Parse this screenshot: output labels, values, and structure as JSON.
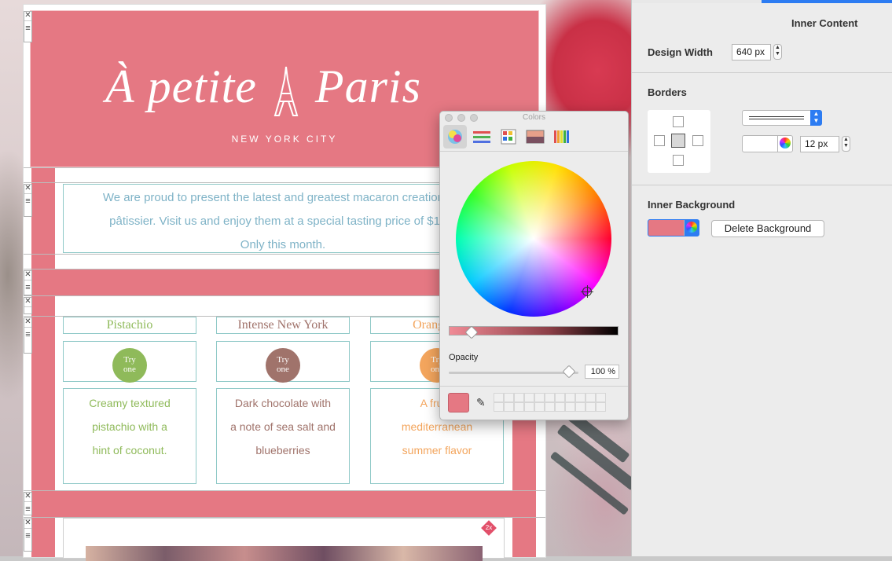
{
  "email": {
    "logo_text_left": "À petite",
    "logo_text_right": "Paris",
    "city": "NEW YORK CITY",
    "intro_lines": [
      "We are proud to present the latest and greatest macaron creations of",
      "pâtissier. Visit us and enjoy them at a special tasting price of $1.89",
      "Only this month."
    ],
    "badge_text_1": "Try",
    "badge_text_2": "one",
    "retina_badge": "2x",
    "flavors": [
      {
        "title": "Pistachio",
        "color": "#8fba5a",
        "desc": [
          "Creamy textured",
          "pistachio with a",
          "hint of coconut."
        ]
      },
      {
        "title": "Intense New York",
        "color": "#a0736b",
        "desc": [
          "Dark chocolate with",
          "a note of sea salt and",
          "blueberries"
        ]
      },
      {
        "title": "Orange B",
        "color": "#f3a55d",
        "desc": [
          "A fruity",
          "mediterranean",
          "summer flavor"
        ]
      }
    ],
    "brand_color": "#e57883",
    "accent_border": "#8fc9c7"
  },
  "colors_panel": {
    "title": "Colors",
    "opacity_label": "Opacity",
    "opacity_value": "100 %",
    "opacity_fraction": 1.0,
    "brightness_fraction": 0.1,
    "current_color": "#e57883"
  },
  "inspector": {
    "section_title": "Inner Content",
    "design_width_label": "Design Width",
    "design_width_value": "640 px",
    "borders_label": "Borders",
    "border_width_value": "12 px",
    "inner_bg_label": "Inner Background",
    "delete_bg_label": "Delete Background",
    "accent_color": "#2d7cf2"
  }
}
